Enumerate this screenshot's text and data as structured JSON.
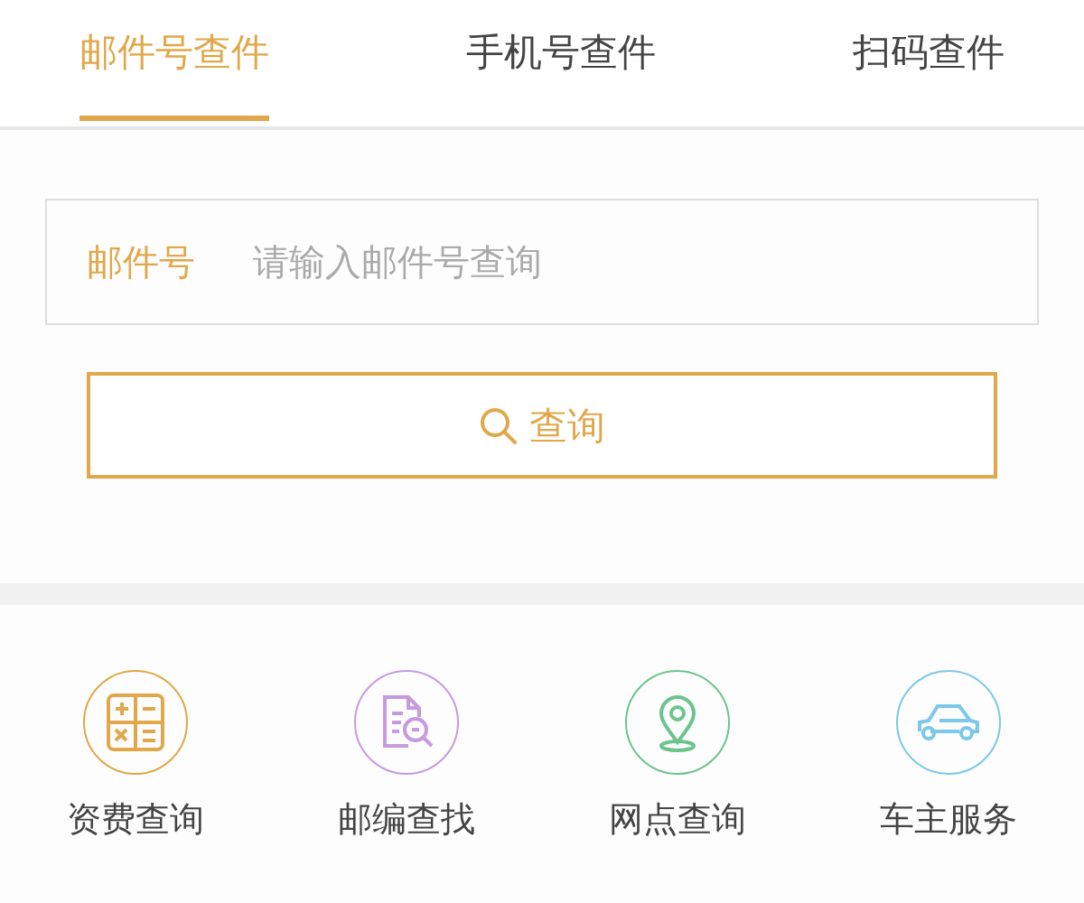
{
  "tabs": [
    {
      "label": "邮件号查件",
      "selected": true
    },
    {
      "label": "手机号查件",
      "selected": false
    },
    {
      "label": "扫码查件",
      "selected": false
    }
  ],
  "query_field": {
    "label": "邮件号",
    "placeholder": "请输入邮件号查询"
  },
  "query_button": {
    "label": "查询"
  },
  "services": [
    {
      "label": "资费查询",
      "kind": "calculator",
      "color": "#e0a84a"
    },
    {
      "label": "邮编查找",
      "kind": "document",
      "color": "#c79ae0"
    },
    {
      "label": "网点查询",
      "kind": "pin",
      "color": "#6cc48c"
    },
    {
      "label": "车主服务",
      "kind": "car",
      "color": "#7cc8e8"
    }
  ]
}
